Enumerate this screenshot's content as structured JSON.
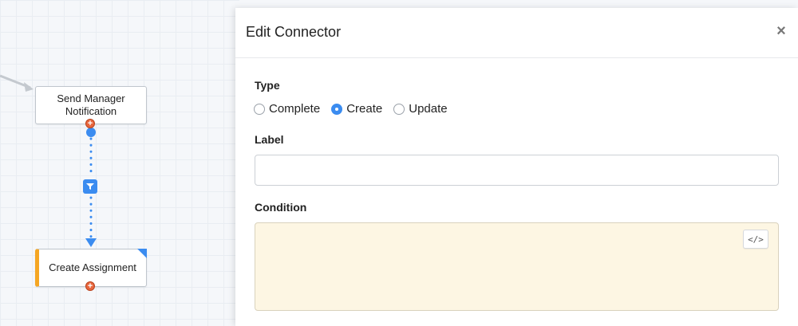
{
  "canvas": {
    "nodes": [
      {
        "label": "Send Manager Notification"
      },
      {
        "label": "Create Assignment"
      }
    ],
    "connector_filter_icon": "filter-icon",
    "accent_color": "#3b8cf0",
    "warning_color": "#f5a623"
  },
  "dialog": {
    "title": "Edit Connector",
    "close_icon": "close-icon",
    "type_label": "Type",
    "type_options": [
      {
        "label": "Complete",
        "checked": false
      },
      {
        "label": "Create",
        "checked": true
      },
      {
        "label": "Update",
        "checked": false
      }
    ],
    "label_field_label": "Label",
    "label_value": "",
    "condition_label": "Condition",
    "condition_value": "",
    "code_button_icon": "code-icon",
    "code_button_glyph": "</>"
  }
}
